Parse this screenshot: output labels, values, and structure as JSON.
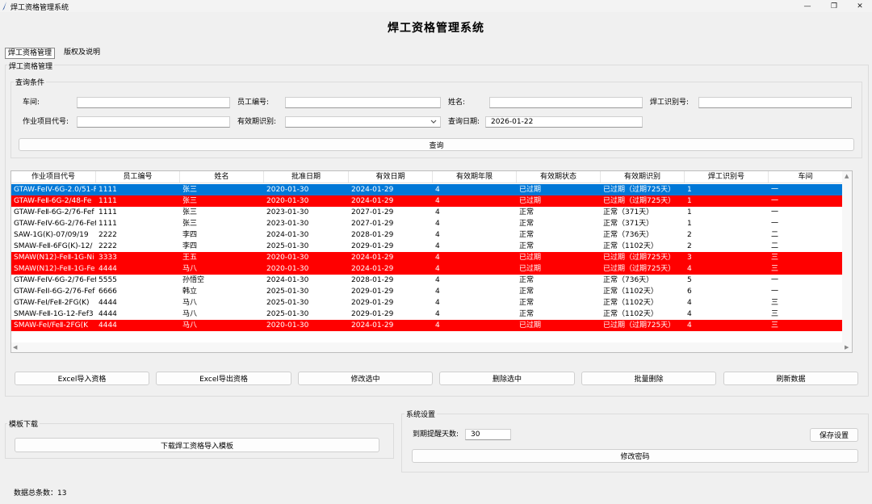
{
  "window": {
    "title": "焊工资格管理系统",
    "minimize": "—",
    "restore": "❐",
    "close": "✕"
  },
  "app": {
    "main_title": "焊工资格管理系统"
  },
  "tabs": [
    {
      "label": "焊工资格管理"
    },
    {
      "label": "版权及说明"
    }
  ],
  "outer_group": {
    "label": "焊工资格管理"
  },
  "query": {
    "group_label": "查询条件",
    "workshop_label": "车间:",
    "workshop_value": "",
    "employee_no_label": "员工编号:",
    "employee_no_value": "",
    "name_label": "姓名:",
    "name_value": "",
    "welder_id_label": "焊工识别号:",
    "welder_id_value": "",
    "item_code_label": "作业项目代号:",
    "item_code_value": "",
    "validity_label": "有效期识别:",
    "validity_value": "",
    "date_label": "查询日期:",
    "date_value": "2026-01-22",
    "query_button": "查询"
  },
  "table": {
    "columns": [
      "作业项目代号",
      "员工编号",
      "姓名",
      "批准日期",
      "有效日期",
      "有效期年限",
      "有效期状态",
      "有效期识别",
      "焊工识别号",
      "车间"
    ],
    "rows": [
      {
        "style": "blue",
        "cells": [
          "GTAW-FeIV-6G-2.0/51-F",
          "1111",
          "张三",
          "2020-01-30",
          "2024-01-29",
          "4",
          "已过期",
          "已过期（过期725天）",
          "1",
          "一"
        ]
      },
      {
        "style": "red",
        "cells": [
          "GTAW-FeⅡ-6G-2/48-Fe",
          "1111",
          "张三",
          "2020-01-30",
          "2024-01-29",
          "4",
          "已过期",
          "已过期（过期725天）",
          "1",
          "一"
        ]
      },
      {
        "style": "",
        "cells": [
          "GTAW-FeⅡ-6G-2/76-Fef",
          "1111",
          "张三",
          "2023-01-30",
          "2027-01-29",
          "4",
          "正常",
          "正常（371天）",
          "1",
          "一"
        ]
      },
      {
        "style": "",
        "cells": [
          "GTAW-FeIV-6G-2/76-Fef",
          "1111",
          "张三",
          "2023-01-30",
          "2027-01-29",
          "4",
          "正常",
          "正常（371天）",
          "1",
          "一"
        ]
      },
      {
        "style": "",
        "cells": [
          "SAW-1G(K)-07/09/19",
          "2222",
          "李四",
          "2024-01-30",
          "2028-01-29",
          "4",
          "正常",
          "正常（736天）",
          "2",
          "二"
        ]
      },
      {
        "style": "",
        "cells": [
          "SMAW-FeⅡ-6FG(K)-12/",
          "2222",
          "李四",
          "2025-01-30",
          "2029-01-29",
          "4",
          "正常",
          "正常（1102天）",
          "2",
          "二"
        ]
      },
      {
        "style": "red",
        "cells": [
          "SMAW(N12)-FeⅡ-1G-Ni",
          "3333",
          "王五",
          "2020-01-30",
          "2024-01-29",
          "4",
          "已过期",
          "已过期（过期725天）",
          "3",
          "三"
        ]
      },
      {
        "style": "red",
        "cells": [
          "SMAW(N12)-FeⅡ-1G-Fe",
          "4444",
          "马八",
          "2020-01-30",
          "2024-01-29",
          "4",
          "已过期",
          "已过期（过期725天）",
          "4",
          "三"
        ]
      },
      {
        "style": "",
        "cells": [
          "GTAW-FeIV-6G-2/76-Fef",
          "5555",
          "孙悟空",
          "2024-01-30",
          "2028-01-29",
          "4",
          "正常",
          "正常（736天）",
          "5",
          "一"
        ]
      },
      {
        "style": "",
        "cells": [
          "GTAW-FeII-6G-2/76-Fef",
          "6666",
          "韩立",
          "2025-01-30",
          "2029-01-29",
          "4",
          "正常",
          "正常（1102天）",
          "6",
          "一"
        ]
      },
      {
        "style": "",
        "cells": [
          "GTAW-FeⅠ/FeⅡ-2FG(K)",
          "4444",
          "马八",
          "2025-01-30",
          "2029-01-29",
          "4",
          "正常",
          "正常（1102天）",
          "4",
          "三"
        ]
      },
      {
        "style": "",
        "cells": [
          "SMAW-FeⅡ-1G-12-Fef3",
          "4444",
          "马八",
          "2025-01-30",
          "2029-01-29",
          "4",
          "正常",
          "正常（1102天）",
          "4",
          "三"
        ]
      },
      {
        "style": "red",
        "cells": [
          "SMAW-FeⅠ/FeⅡ-2FG(K",
          "4444",
          "马八",
          "2020-01-30",
          "2024-01-29",
          "4",
          "已过期",
          "已过期（过期725天）",
          "4",
          "三"
        ]
      }
    ]
  },
  "actions": [
    "Excel导入资格",
    "Excel导出资格",
    "修改选中",
    "删除选中",
    "批量删除",
    "刷新数据"
  ],
  "template": {
    "group_label": "模板下载",
    "download_button": "下载焊工资格导入模板"
  },
  "settings": {
    "group_label": "系统设置",
    "remind_label": "到期提醒天数:",
    "remind_value": "30",
    "save_button": "保存设置",
    "change_password_button": "修改密码"
  },
  "status": {
    "text": "数据总条数：13"
  },
  "colors": {
    "selected_row": "#0078d7",
    "expired_row": "#ff0000",
    "background": "#f0f0f0"
  }
}
